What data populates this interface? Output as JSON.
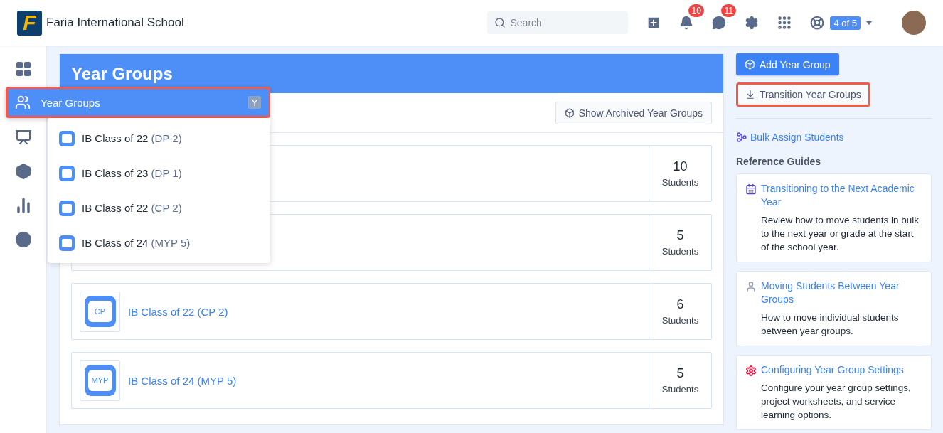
{
  "header": {
    "logo_letter": "F",
    "school_name": "Faria International School",
    "search": {
      "placeholder": "Search"
    },
    "notifications": "10",
    "messages": "11",
    "support_progress": "4 of 5"
  },
  "page": {
    "title": "Year Groups",
    "archived_button": "Show Archived Year Groups",
    "rows": [
      {
        "count": "10",
        "unit": "Students"
      },
      {
        "count": "5",
        "unit": "Students"
      },
      {
        "badge": "CP",
        "name": "IB Class of 22 (CP 2)",
        "count": "6",
        "unit": "Students"
      },
      {
        "badge": "MYP",
        "name": "IB Class of 24 (MYP 5)",
        "count": "5",
        "unit": "Students"
      }
    ]
  },
  "flyout": {
    "title": "Year Groups",
    "shortcut": "Y",
    "highlighted": true,
    "items": [
      {
        "name": "IB Class of 22",
        "code": "(DP 2)"
      },
      {
        "name": "IB Class of 23",
        "code": "(DP 1)"
      },
      {
        "name": "IB Class of 22",
        "code": "(CP 2)"
      },
      {
        "name": "IB Class of 24",
        "code": "(MYP 5)"
      }
    ]
  },
  "aside": {
    "add_button": "Add Year Group",
    "transition_button": {
      "label": "Transition Year Groups",
      "highlighted": true
    },
    "bulk_link": "Bulk Assign Students",
    "guides_heading": "Reference Guides",
    "guides": [
      {
        "kind": "calendar",
        "color": "#4f46e5",
        "title": "Transitioning to the Next Academic Year",
        "description": "Review how to move students in bulk to the next year or grade at the start of the school year."
      },
      {
        "kind": "person",
        "color": "#94a3b8",
        "title": "Moving Students Between Year Groups",
        "description": "How to move individual students between year groups."
      },
      {
        "kind": "gear",
        "color": "#e11d48",
        "title": "Configuring Year Group Settings",
        "description": "Configure your year group settings, project worksheets, and service learning options."
      }
    ]
  }
}
